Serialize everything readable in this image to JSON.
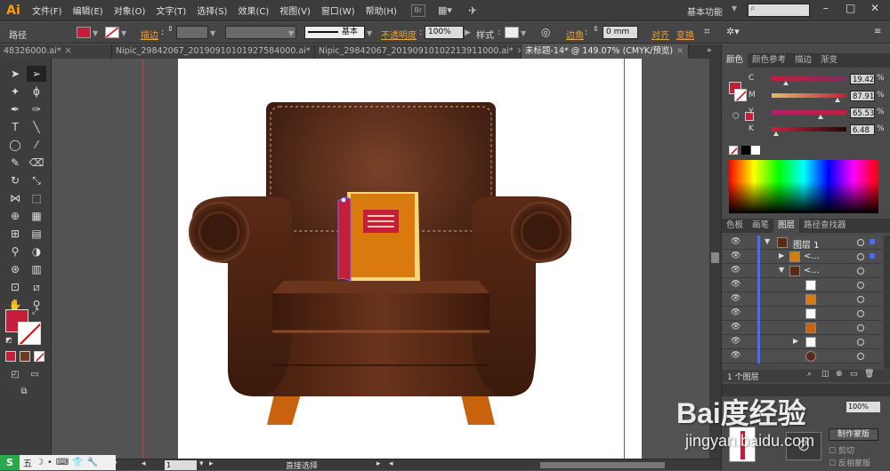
{
  "app": {
    "logo": "Ai"
  },
  "menu": [
    "文件(F)",
    "编辑(E)",
    "对象(O)",
    "文字(T)",
    "选择(S)",
    "效果(C)",
    "视图(V)",
    "窗口(W)",
    "帮助(H)"
  ],
  "menubar": {
    "bridge": "Br",
    "workspace": "基本功能"
  },
  "control": {
    "selection_label": "路径",
    "stroke_label": "描边",
    "brush_label": "基本",
    "opacity_label": "不透明度",
    "opacity_value": "100%",
    "style_label": "样式",
    "corner_label": "边角",
    "corner_value": "0 mm",
    "align_label": "对齐",
    "transform_label": "变换",
    "fill_color": "#c41e3a"
  },
  "tabs": [
    {
      "label": "48326000.ai*",
      "active": false
    },
    {
      "label": "Nipic_29842067_20190910101927584000.ai*",
      "active": false
    },
    {
      "label": "Nipic_29842067_20190910102213911000.ai*",
      "active": false
    },
    {
      "label": "未标题-14* @ 149.07% (CMYK/预览)",
      "active": true
    }
  ],
  "color_panel": {
    "tabs": [
      "颜色",
      "颜色参考",
      "描边",
      "渐变"
    ],
    "c": "19.42",
    "m": "87.91",
    "y": "65.53",
    "k": "6.48",
    "c_level": 0.19,
    "m_level": 0.88,
    "y_level": 0.66,
    "k_level": 0.06,
    "pct": "%"
  },
  "layers_panel": {
    "tabs": [
      "色板",
      "画笔",
      "图层",
      "路径查找器"
    ],
    "top_layer": "图层 1",
    "sub1": "<...",
    "sub2": "<...",
    "count": "1 个图层"
  },
  "lower_panel": {
    "opacity_value": "100%",
    "mask_button": "制作蒙版",
    "clip": "剪切",
    "invert": "反相蒙版"
  },
  "status": {
    "zoom": "149.07%",
    "page": "1",
    "tool": "直接选择"
  },
  "taskbar": [
    "五",
    "☽",
    "•",
    "⌨",
    "👕",
    "🔧"
  ],
  "watermark": {
    "brand": "Bai度经验",
    "url": "jingyan.baidu.com"
  }
}
